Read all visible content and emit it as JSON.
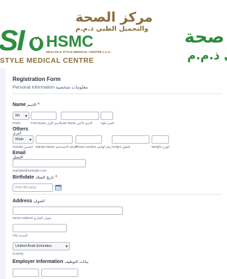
{
  "header": {
    "arabic_title": "مركز الصحة",
    "arabic_subtitle": "والتجميل الطبي ذ.م.م",
    "arabic_big_1": "صحة",
    "arabic_big_2": "بي ذ.م.م",
    "logo_si": "SI",
    "logo_hsmc": "HSMC",
    "logo_hsmc_sub": "HEALTH & STYLE MEDICAL CENTRE L.L.C.",
    "style_line": "STYLE MEDICAL CENTRE"
  },
  "form": {
    "title": "Registration Form",
    "description": "Personal Information معلومات شخصية",
    "name": {
      "label": "Name",
      "label_ar": "الاسم",
      "required": "*",
      "prefix_value": "Mr",
      "sub_prefix": "Prefix",
      "sub_first": "First Name الاسم الأول",
      "sub_last": "Last Name الاسم الأخير",
      "sub_age": "Age العمر"
    },
    "others": {
      "label": "Others",
      "label_ar": "أخرى",
      "gender_value": "Male",
      "sub_gender": "Gender الجنس",
      "sub_marital": "Marital Status الحالة الاجتماعية",
      "sub_phone": "Phone number رقم الهاتف",
      "sub_height": "Height الطول",
      "sub_weight": "Weight الوزن"
    },
    "email": {
      "label": "Email",
      "label_ar": "الإيميل",
      "sub": "example@example.com"
    },
    "birthdate": {
      "label": "Birthdate",
      "label_ar": "تاريخ الميلاد",
      "required": "*",
      "placeholder": "mm-dd-yyyy"
    },
    "address": {
      "label": "Address",
      "label_ar": "العنوان",
      "sub_street": "Street Address عنوان الشارع",
      "sub_city": "City المدينة",
      "country_value": "United Arab Emirates",
      "sub_country": "Country"
    },
    "employer": {
      "label": "Employer Information",
      "label_ar": "بيانات التوظيف"
    }
  },
  "colors": {
    "brand_green": "#2d8e3f",
    "brand_gold": "#8a6d3b",
    "required_red": "#f23a3c",
    "card_background": "#f3f3fe"
  }
}
